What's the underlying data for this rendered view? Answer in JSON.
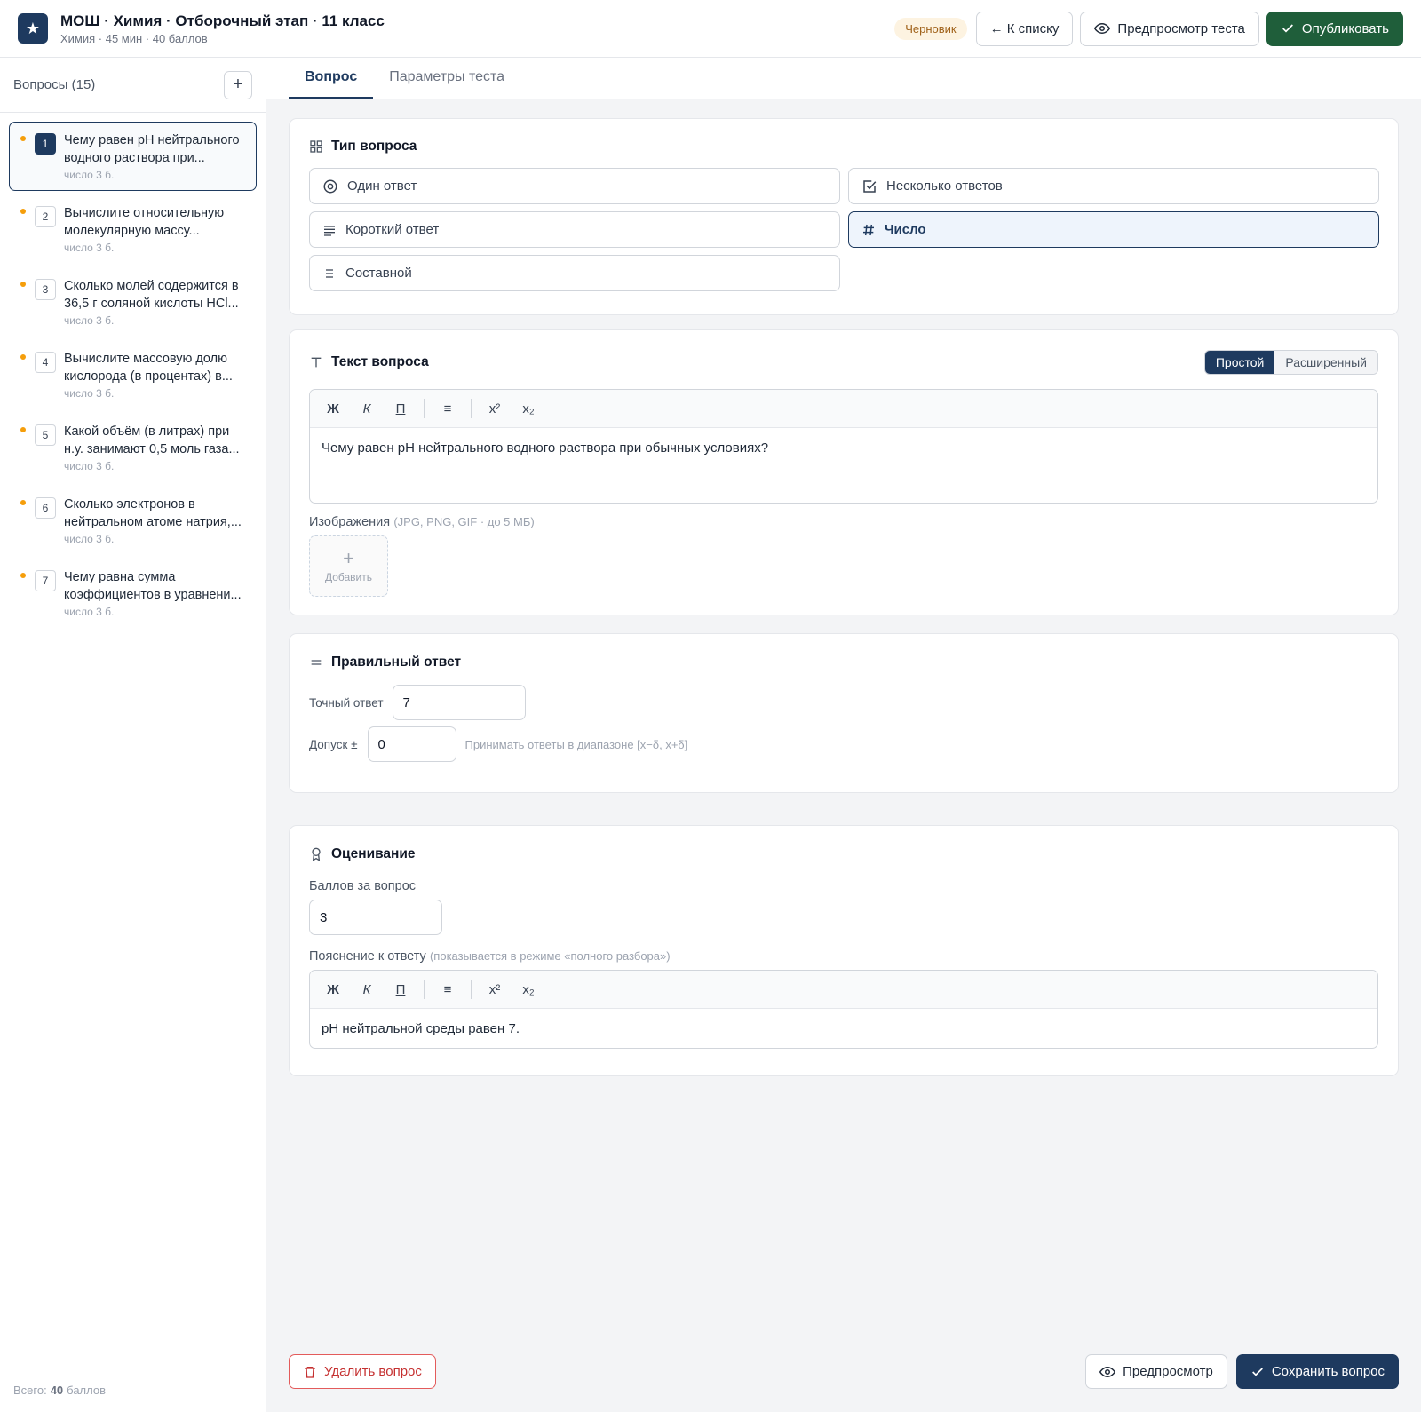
{
  "header": {
    "logo_glyph": "★",
    "title": "МОШ · Химия · Отборочный этап · 11 класс",
    "subtitle": "Химия · 45 мин · 40 баллов",
    "status_badge": "Черновик",
    "back_label": "← К списку",
    "preview_label": "Предпросмотр теста",
    "publish_label": "Опубликовать"
  },
  "sidebar": {
    "heading": "Вопросы (15)",
    "add_glyph": "+",
    "items": [
      {
        "num": "1",
        "text": "Чему равен pH нейтрального водного раствора при...",
        "meta": "число  3 б."
      },
      {
        "num": "2",
        "text": "Вычислите относительную молекулярную массу...",
        "meta": "число  3 б."
      },
      {
        "num": "3",
        "text": "Сколько молей содержится в 36,5 г соляной кислоты HCl...",
        "meta": "число  3 б."
      },
      {
        "num": "4",
        "text": "Вычислите массовую долю кислорода (в процентах) в...",
        "meta": "число  3 б."
      },
      {
        "num": "5",
        "text": "Какой объём (в литрах) при н.у. занимают 0,5 моль газа...",
        "meta": "число  3 б."
      },
      {
        "num": "6",
        "text": "Сколько электронов в нейтральном атоме натрия,...",
        "meta": "число  3 б."
      },
      {
        "num": "7",
        "text": "Чему равна сумма коэффициентов в уравнени...",
        "meta": "число  3 б."
      }
    ],
    "footer_prefix": "Всего:",
    "footer_value": "40",
    "footer_suffix": "баллов"
  },
  "tabs": [
    {
      "label": "Вопрос"
    },
    {
      "label": "Параметры теста"
    }
  ],
  "question_type": {
    "title": "Тип вопроса",
    "options": [
      {
        "label": "Один ответ",
        "icon": "radio-icon"
      },
      {
        "label": "Несколько ответов",
        "icon": "checkbox-icon"
      },
      {
        "label": "Короткий ответ",
        "icon": "lines-icon"
      },
      {
        "label": "Число",
        "icon": "hash-icon"
      },
      {
        "label": "Составной",
        "icon": "list-icon"
      }
    ],
    "selected": "Число"
  },
  "question_text": {
    "title": "Текст вопроса",
    "mode_simple": "Простой",
    "mode_advanced": "Расширенный",
    "toolbar": {
      "bold": "Ж",
      "italic": "К",
      "underline": "П",
      "list": "≡",
      "sup": "x²",
      "sub": "x₂"
    },
    "content": "Чему равен pH нейтрального водного раствора при обычных условиях?",
    "images_label": "Изображения",
    "images_hint": "(JPG, PNG, GIF · до 5 МБ)",
    "add_image_glyph": "+",
    "add_image_label": "Добавить"
  },
  "correct_answer": {
    "title": "Правильный ответ",
    "exact_label": "Точный ответ",
    "exact_value": "7",
    "tolerance_label": "Допуск ±",
    "tolerance_value": "0",
    "tolerance_hint": "Принимать ответы в диапазоне [x−δ, x+δ]"
  },
  "grading": {
    "title": "Оценивание",
    "points_label": "Баллов за вопрос",
    "points_value": "3",
    "explanation_label": "Пояснение к ответу",
    "explanation_hint": "(показывается в режиме «полного разбора»)",
    "toolbar": {
      "bold": "Ж",
      "italic": "К",
      "underline": "П",
      "list": "≡",
      "sup": "x²",
      "sub": "x₂"
    },
    "explanation_content": "pH нейтральной среды равен 7."
  },
  "footer": {
    "delete_label": "Удалить вопрос",
    "preview_label": "Предпросмотр",
    "save_label": "Сохранить вопрос"
  },
  "colors": {
    "accent": "#1e3a5f",
    "publish": "#1f5e3a",
    "status_dot": "#f59e0b",
    "danger": "#c53030"
  }
}
